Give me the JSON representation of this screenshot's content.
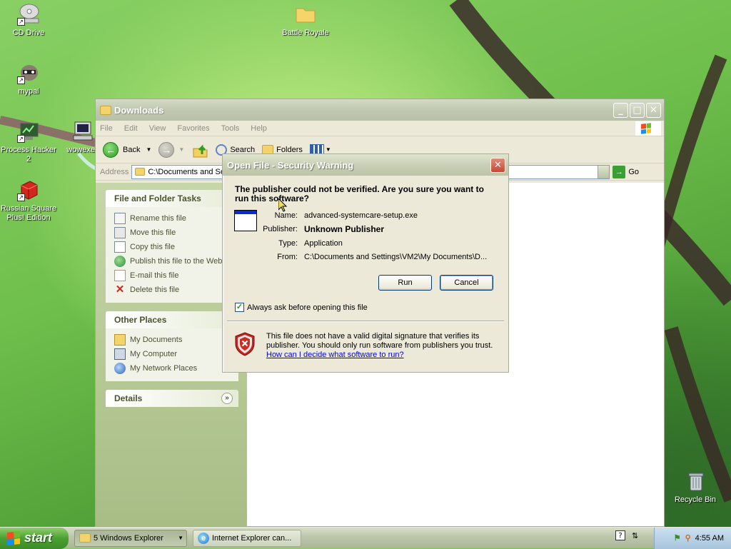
{
  "desktop": {
    "icons": [
      {
        "label": "CD Drive"
      },
      {
        "label": "Battle Royale"
      },
      {
        "label": "mypal"
      },
      {
        "label": "Process Hacker 2"
      },
      {
        "label": "wowexec"
      },
      {
        "label": "Russian Square Plus! Edition"
      },
      {
        "label": "Recycle Bin"
      }
    ]
  },
  "explorer": {
    "title": "Downloads",
    "menu": [
      "File",
      "Edit",
      "View",
      "Favorites",
      "Tools",
      "Help"
    ],
    "toolbar": {
      "back": "Back",
      "search": "Search",
      "folders": "Folders"
    },
    "address_label": "Address",
    "address_value": "C:\\Documents and Se",
    "go_label": "Go",
    "tasks_header": "File and Folder Tasks",
    "tasks": [
      "Rename this file",
      "Move this file",
      "Copy this file",
      "Publish this file to the Web",
      "E-mail this file",
      "Delete this file"
    ],
    "other_header": "Other Places",
    "other": [
      "My Documents",
      "My Computer",
      "My Network Places"
    ],
    "details_header": "Details"
  },
  "dialog": {
    "title": "Open File - Security Warning",
    "question": "The publisher could not be verified.  Are you sure you want to run this software?",
    "fields": {
      "name_label": "Name:",
      "name_value": "advanced-systemcare-setup.exe",
      "publisher_label": "Publisher:",
      "publisher_value": "Unknown Publisher",
      "type_label": "Type:",
      "type_value": "Application",
      "from_label": "From:",
      "from_value": "C:\\Documents and Settings\\VM2\\My Documents\\D..."
    },
    "run_label": "Run",
    "cancel_label": "Cancel",
    "always_ask_label": "Always ask before opening this file",
    "always_ask_checked": true,
    "warning_text": "This file does not have a valid digital signature that verifies its publisher.  You should only run software from publishers you trust.",
    "help_link": "How can I decide what software to run?"
  },
  "taskbar": {
    "start_label": "start",
    "tasks": [
      {
        "label": "5 Windows Explorer"
      },
      {
        "label": "Internet Explorer can..."
      }
    ],
    "clock": "4:55 AM"
  }
}
